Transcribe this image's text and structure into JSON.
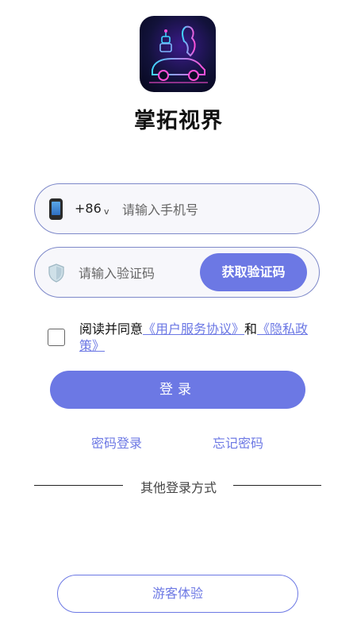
{
  "app": {
    "name": "掌拓视界",
    "logo_icon": "car-neon-logo-icon"
  },
  "phone_field": {
    "icon": "mobile-phone-icon",
    "country_code": "+86",
    "chevron": "v",
    "value": "",
    "placeholder": "请输入手机号"
  },
  "code_field": {
    "icon": "shield-icon",
    "value": "",
    "placeholder": "请输入验证码",
    "button_label": "获取验证码"
  },
  "agreement": {
    "checked": false,
    "prefix": "阅读并同意",
    "user_agreement": "《用户服务协议》",
    "conjunction": "和",
    "privacy_policy": "《隐私政策》"
  },
  "login_button": "登录",
  "links": {
    "password_login": "密码登录",
    "forgot_password": "忘记密码"
  },
  "other_login": "其他登录方式",
  "guest_button": "游客体验",
  "colors": {
    "accent": "#6c78e4",
    "field_border": "#7d88c9"
  }
}
